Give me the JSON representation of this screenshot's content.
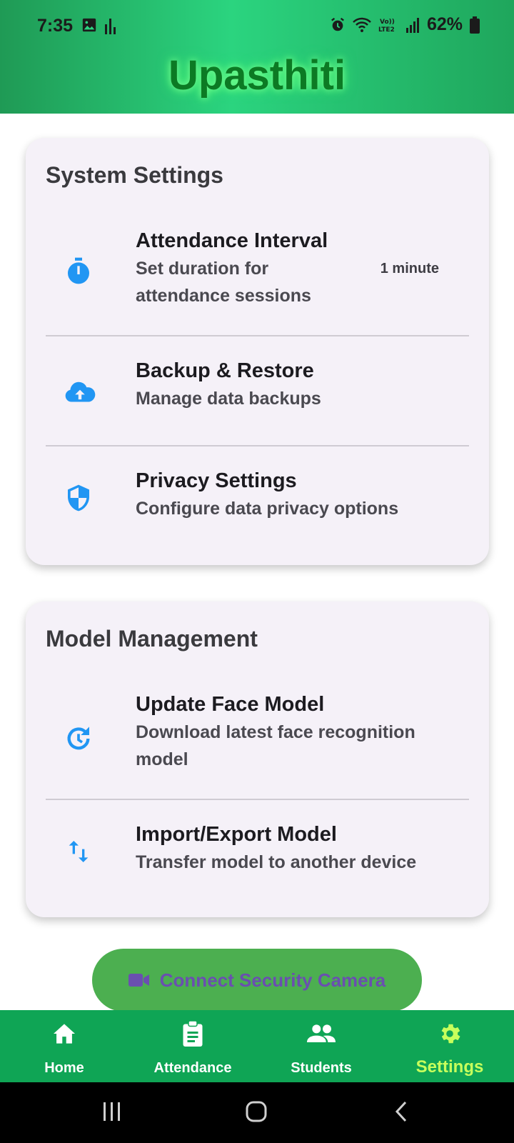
{
  "status_bar": {
    "time": "7:35",
    "battery": "62%",
    "icons": [
      "image-icon",
      "signal-bars-icon",
      "alarm-icon",
      "wifi-icon",
      "volte-lte2-icon",
      "cell-signal-icon",
      "battery-icon"
    ]
  },
  "app": {
    "title": "Upasthiti",
    "title_color": "#0c7a24",
    "header_color": "#2bd47f"
  },
  "system_settings": {
    "title": "System Settings",
    "items": [
      {
        "icon": "timer-icon",
        "title": "Attendance Interval",
        "subtitle": "Set duration for attendance sessions",
        "value": "1 minute"
      },
      {
        "icon": "cloud-upload-icon",
        "title": "Backup & Restore",
        "subtitle": "Manage data backups"
      },
      {
        "icon": "shield-icon",
        "title": "Privacy Settings",
        "subtitle": "Configure data privacy options"
      }
    ]
  },
  "model_management": {
    "title": "Model Management",
    "items": [
      {
        "icon": "refresh-icon",
        "title": "Update Face Model",
        "subtitle": "Download latest face recognition model"
      },
      {
        "icon": "swap-vertical-icon",
        "title": "Import/Export Model",
        "subtitle": "Transfer model to another device"
      }
    ]
  },
  "cta": {
    "icon": "videocam-icon",
    "label": "Connect Security Camera",
    "color": "#4caf50"
  },
  "bottom_nav": {
    "active": "Settings",
    "active_color": "#c7ff5c",
    "items": [
      {
        "icon": "home-icon",
        "label": "Home"
      },
      {
        "icon": "clipboard-icon",
        "label": "Attendance"
      },
      {
        "icon": "people-icon",
        "label": "Students"
      },
      {
        "icon": "gear-icon",
        "label": "Settings"
      }
    ]
  },
  "colors": {
    "icon_blue": "#2196f3",
    "nav_green": "#0fa555",
    "card_bg": "#f5f1f8"
  }
}
